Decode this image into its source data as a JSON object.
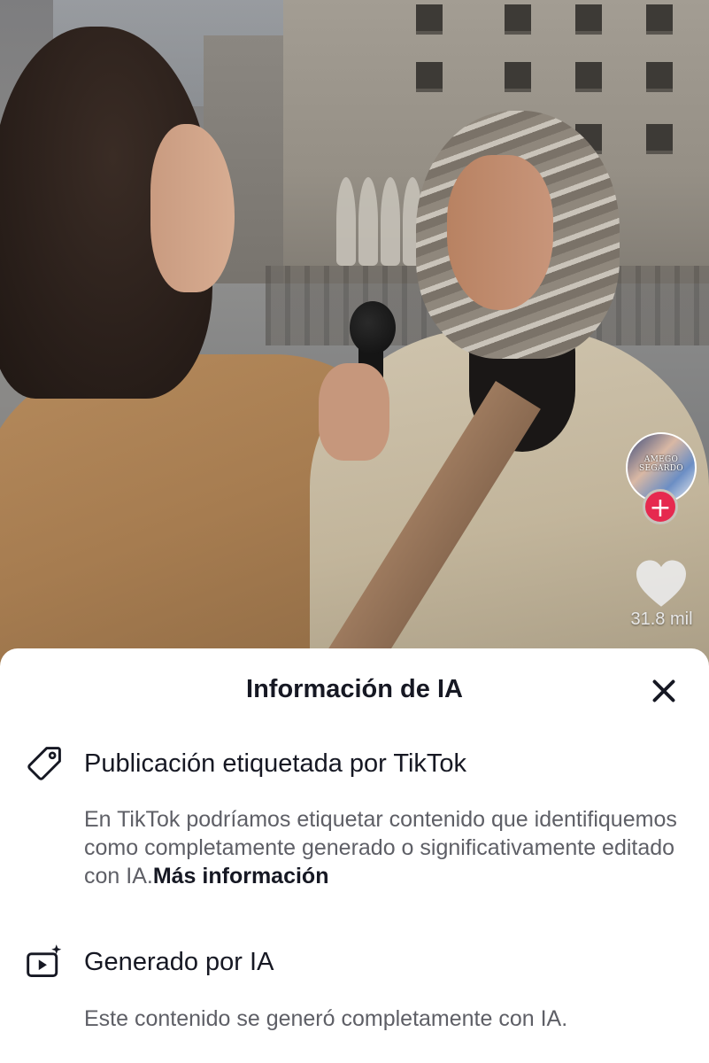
{
  "video": {
    "creator_avatar_text": "AMEGO SEGARDO",
    "follow_symbol": "+",
    "like_count": "31.8 mil"
  },
  "sheet": {
    "title": "Información de IA",
    "close_icon": "close-icon",
    "sections": [
      {
        "icon": "tag-icon",
        "title": "Publicación etiquetada por TikTok",
        "description": "En TikTok podríamos etiquetar contenido que identifiquemos como completamente generado o significativamente editado con IA.",
        "link": "Más información"
      },
      {
        "icon": "ai-video-icon",
        "title": "Generado por IA",
        "description": "Este contenido se generó completamente con IA."
      }
    ]
  },
  "colors": {
    "accent_red": "#e6294f",
    "text_primary": "#161823",
    "text_secondary": "#5e5f66"
  }
}
